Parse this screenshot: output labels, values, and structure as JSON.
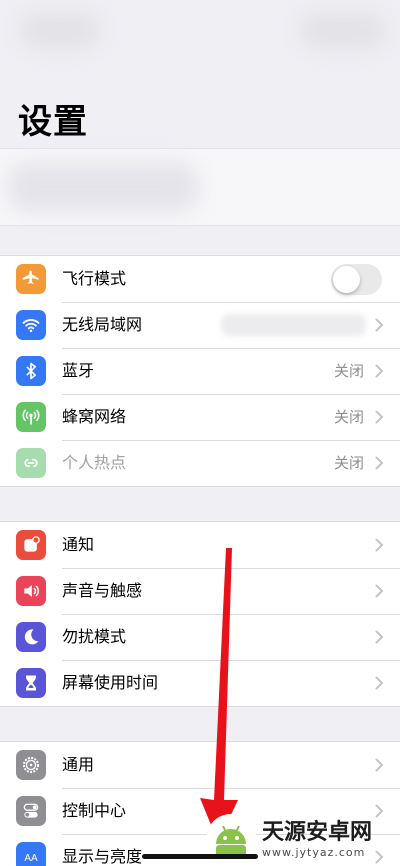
{
  "title": "设置",
  "groups": [
    [
      {
        "label": "飞行模式",
        "icon": "airplane-icon",
        "color": "#f19a37",
        "control": "toggle",
        "toggle_on": false
      },
      {
        "label": "无线局域网",
        "icon": "wifi-icon",
        "color": "#3478f6",
        "control": "chevron",
        "value": ""
      },
      {
        "label": "蓝牙",
        "icon": "bluetooth-icon",
        "color": "#3478f6",
        "control": "chevron",
        "value": "关闭"
      },
      {
        "label": "蜂窝网络",
        "icon": "cellular-icon",
        "color": "#65c466",
        "control": "chevron",
        "value": "关闭"
      },
      {
        "label": "个人热点",
        "icon": "hotspot-icon",
        "color": "#a6dcae",
        "control": "chevron",
        "value": "关闭",
        "disabled": true
      }
    ],
    [
      {
        "label": "通知",
        "icon": "notifications-icon",
        "color": "#eb4d3d",
        "control": "chevron"
      },
      {
        "label": "声音与触感",
        "icon": "sound-icon",
        "color": "#e9445a",
        "control": "chevron"
      },
      {
        "label": "勿扰模式",
        "icon": "moon-icon",
        "color": "#5856d6",
        "control": "chevron"
      },
      {
        "label": "屏幕使用时间",
        "icon": "hourglass-icon",
        "color": "#5856d6",
        "control": "chevron"
      }
    ],
    [
      {
        "label": "通用",
        "icon": "gear-icon",
        "color": "#8e8e93",
        "control": "chevron"
      },
      {
        "label": "控制中心",
        "icon": "switches-icon",
        "color": "#8e8e93",
        "control": "chevron"
      },
      {
        "label": "显示与亮度",
        "icon": "display-icon",
        "color": "#3478f6",
        "control": "chevron"
      }
    ]
  ],
  "watermark": {
    "title": "天源安卓网",
    "url": "www.jytyaz.com"
  },
  "annotation_color": "#e8121b"
}
